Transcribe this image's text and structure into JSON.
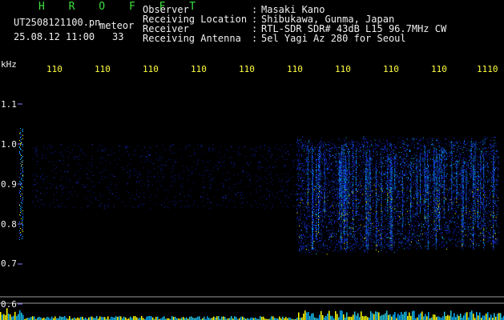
{
  "header": {
    "title": "H R O F F T",
    "filename": "UT2508121100.pn",
    "mode": "meteor",
    "date_time": "25.08.12 11:00",
    "count": "33",
    "info_rows": [
      {
        "label": "Observer",
        "sep": ":",
        "value": "Masaki Kano"
      },
      {
        "label": "Receiving Location",
        "sep": ":",
        "value": "Shibukawa, Gunma, Japan"
      },
      {
        "label": "Receiver",
        "sep": ":",
        "value": "RTL-SDR SDR# 43dB L15 96.7MHz CW"
      },
      {
        "label": "Receiving Antenna",
        "sep": ":",
        "value": "5el Yagi Az 280 for Seoul"
      }
    ]
  },
  "axes": {
    "y_unit": "kHz",
    "y_ticks": [
      "1.1",
      "1.0",
      "0.9",
      "0.8",
      "0.7",
      "0.6"
    ],
    "x_ticks": [
      "110",
      "110",
      "110",
      "110",
      "110",
      "110",
      "110",
      "110",
      "110",
      "1110"
    ]
  },
  "colors": {
    "background": "#000000",
    "title": "#3ce03c",
    "tick_labels": "#ffff40",
    "text": "#f0f0f0",
    "signal_low": "#0a1a8a",
    "signal_mid": "#00b0ff",
    "signal_high": "#ffff00"
  }
}
